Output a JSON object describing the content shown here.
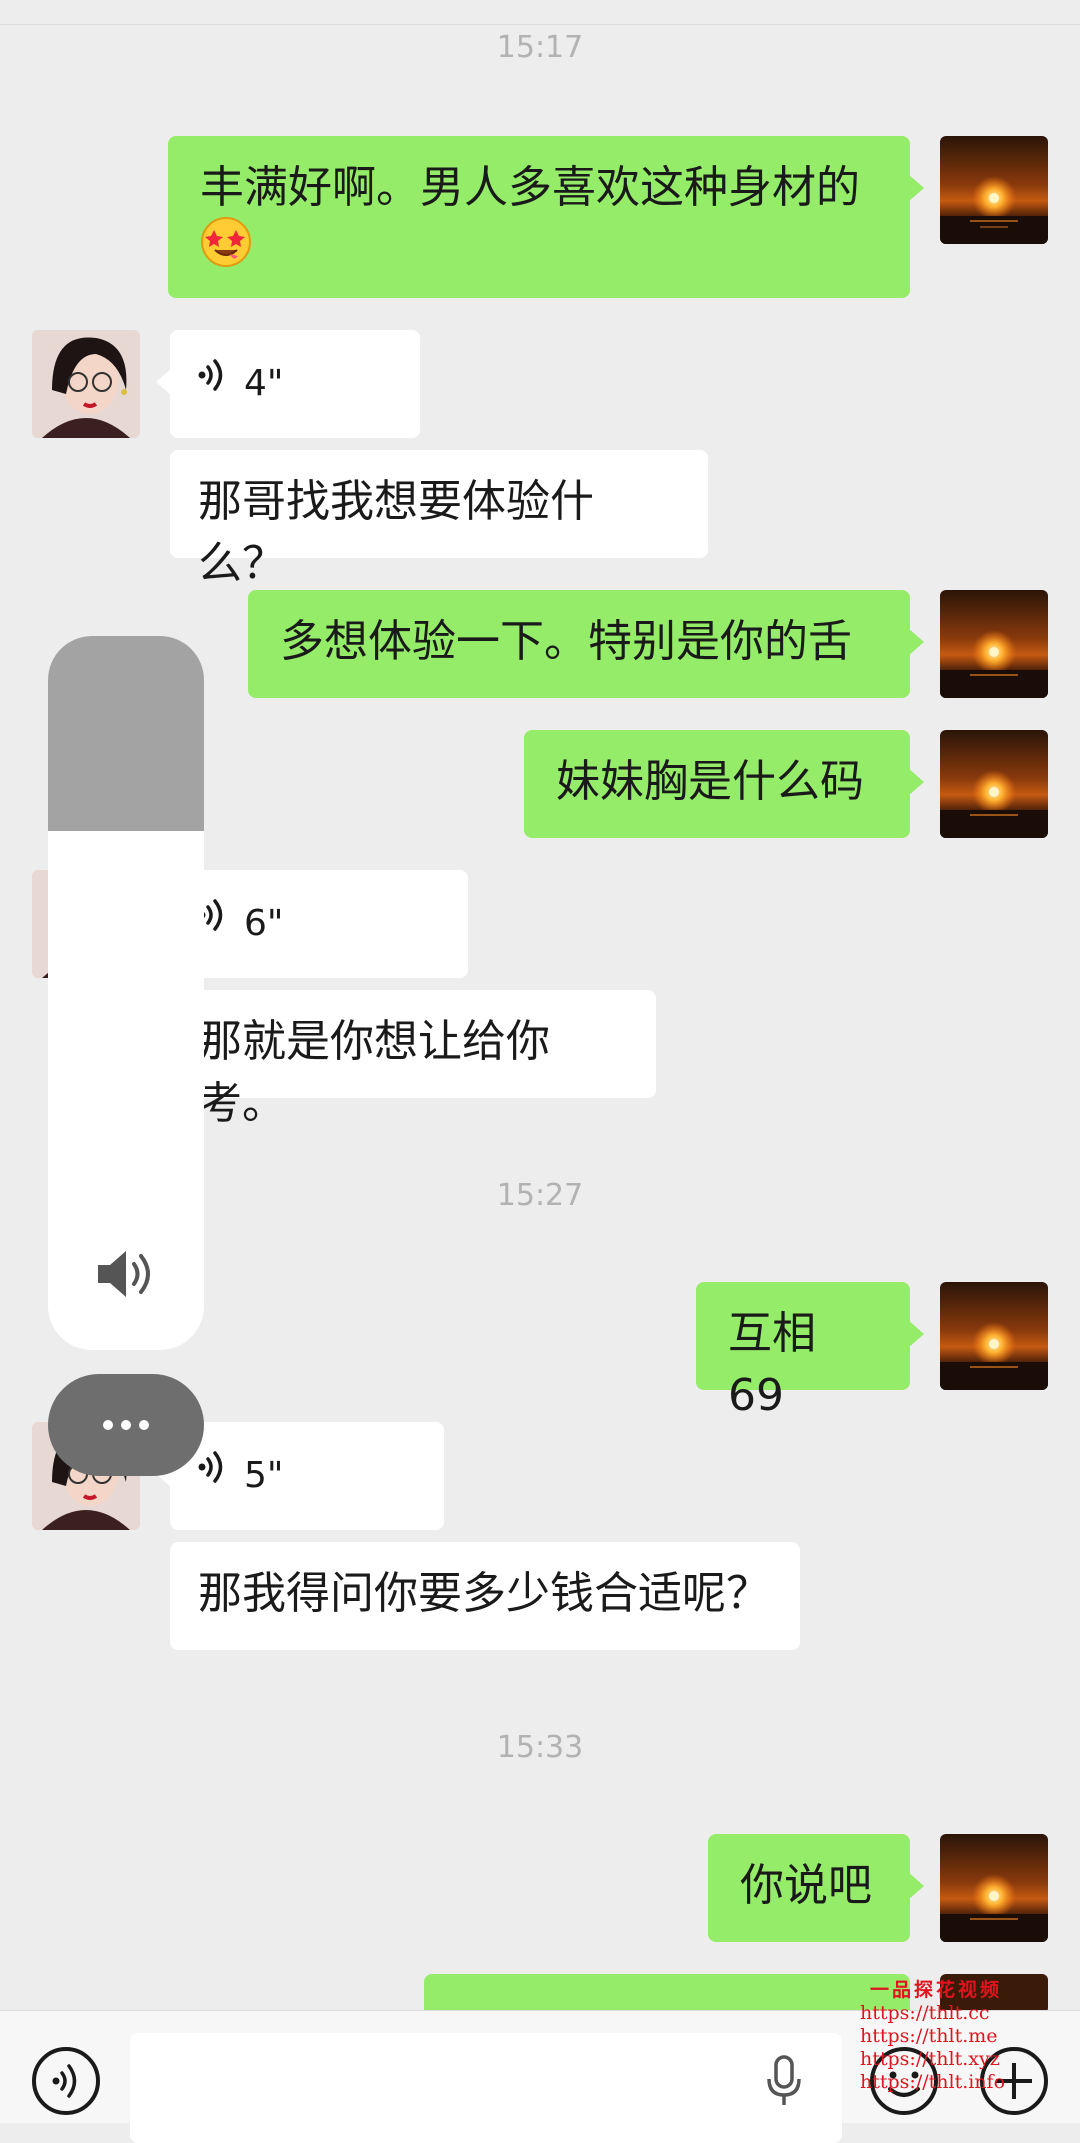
{
  "colors": {
    "background": "#ededed",
    "outgoing_bubble": "#95ec69",
    "incoming_bubble": "#ffffff",
    "timestamp": "#b2b2b2",
    "watermark": "#e0141e"
  },
  "timestamps": [
    "15:17",
    "15:27",
    "15:33"
  ],
  "messages": [
    {
      "side": "out",
      "type": "text",
      "line1": "丰满好啊。男人多喜欢这种身材的",
      "emoji": "star-struck-face-emoji"
    },
    {
      "side": "in",
      "type": "voice",
      "duration": "4\""
    },
    {
      "side": "in",
      "type": "text",
      "text": "那哥找我想要体验什么？"
    },
    {
      "side": "out",
      "type": "text",
      "text": "多想体验一下。特别是你的舌"
    },
    {
      "side": "out",
      "type": "text",
      "text": "妹妹胸是什么码"
    },
    {
      "side": "in",
      "type": "voice",
      "duration": "6\""
    },
    {
      "side": "in",
      "type": "text",
      "text": "那就是你想让给你考。"
    },
    {
      "side": "out",
      "type": "text",
      "text": "互相 69"
    },
    {
      "side": "in",
      "type": "voice",
      "duration": "5\""
    },
    {
      "side": "in",
      "type": "text",
      "text": "那我得问你要多少钱合适呢？"
    },
    {
      "side": "out",
      "type": "text",
      "text": "你说吧"
    }
  ],
  "volume_overlay": {
    "level": 0.58,
    "icon": "speaker-icon",
    "more_icon": "more-dots-icon"
  },
  "bottom_bar": {
    "voice_icon": "voice-mode-icon",
    "mic_icon": "microphone-icon",
    "emoji_icon": "emoji-icon",
    "plus_icon": "plus-icon",
    "input_value": ""
  },
  "watermark": {
    "title": "一品探花视频",
    "lines": [
      "https://thlt.cc",
      "https://thlt.me",
      "https://thlt.xyz",
      "https://thlt.info"
    ]
  }
}
